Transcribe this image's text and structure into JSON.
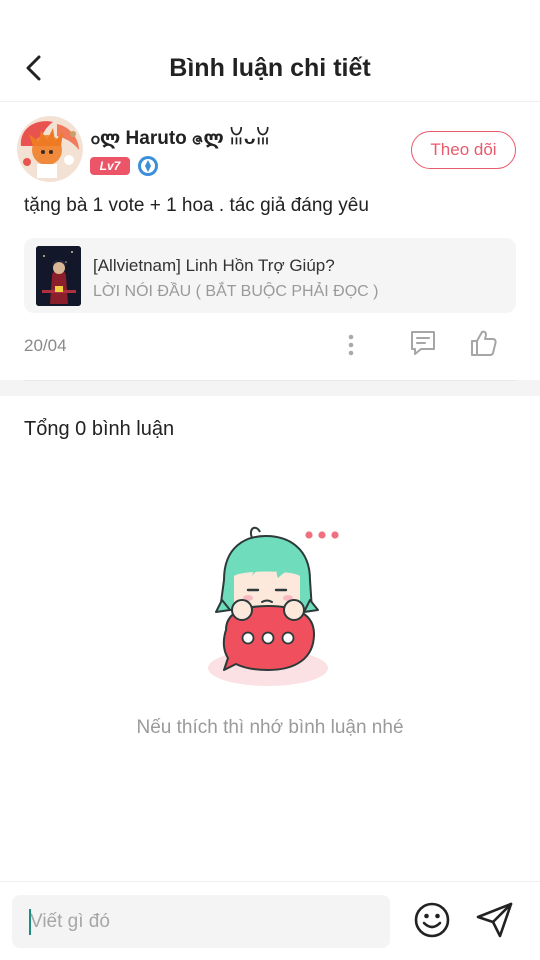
{
  "header": {
    "title": "Bình luận chi tiết"
  },
  "post": {
    "username": "ჿლ Haruto ဇლ ꈍᴗꈍ",
    "level": "Lv7",
    "follow_label": "Theo dõi",
    "text": "tặng bà 1 vote + 1 hoa . tác giả đáng yêu",
    "story": {
      "title": "[Allvietnam] Linh Hồn Trợ Giúp?",
      "chapter": "LỜI NÓI ĐẦU ( BẮT BUỘC PHẢI ĐỌC )"
    },
    "date": "20/04"
  },
  "comments": {
    "total_label": "Tổng 0 bình luận",
    "empty_message": "Nếu thích thì nhớ bình luận nhé"
  },
  "input": {
    "placeholder": "Viết gì đó"
  },
  "icons": {
    "back": "chevron-left-icon",
    "more": "more-vertical-icon",
    "comment": "comment-icon",
    "like": "thumbs-up-icon",
    "emoji": "smiley-icon",
    "send": "send-icon"
  },
  "colors": {
    "accent": "#e85a6c",
    "level_badge": "#ec5568",
    "caret": "#1e8c7e",
    "mascot_hair": "#6fdcbc"
  }
}
